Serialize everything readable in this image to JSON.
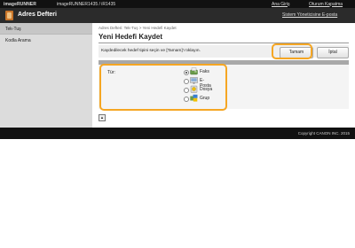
{
  "topbar": {
    "brand": "imageRUNNER",
    "model": "imageRUNNER1435 / iR1435",
    "links": [
      "Ana Giriş",
      "Oturum Kapatma"
    ]
  },
  "titlebar": {
    "title": "Adres Defteri",
    "admin_link": "Sistem Yöneticisine E-posta"
  },
  "sidebar": {
    "items": [
      {
        "label": "Tek-Tuş"
      },
      {
        "label": "Kodla Arama"
      }
    ]
  },
  "content": {
    "breadcrumb": "Adres Defteri: Tek-Tuş > Yeni Hedefi Kaydet",
    "heading": "Yeni Hedefi Kaydet",
    "instruction": "Kaydedilecek hedef tipini seçin ve [Tamam]'ı tıklayın.",
    "ok_label": "Tamam",
    "cancel_label": "İptal",
    "type_label": "Tür:",
    "options": [
      {
        "label": "Faks",
        "selected": true,
        "icon": "fax-icon"
      },
      {
        "label": "E-Posta",
        "selected": false,
        "icon": "email-icon"
      },
      {
        "label": "Dosya",
        "selected": false,
        "icon": "file-icon"
      },
      {
        "label": "Grup",
        "selected": false,
        "icon": "group-icon"
      }
    ]
  },
  "footer": {
    "copyright": "Copyright CANON INC. 2015"
  },
  "colors": {
    "highlight": "#f5a623",
    "header": "#2b2b2b",
    "topbar": "#111111"
  }
}
